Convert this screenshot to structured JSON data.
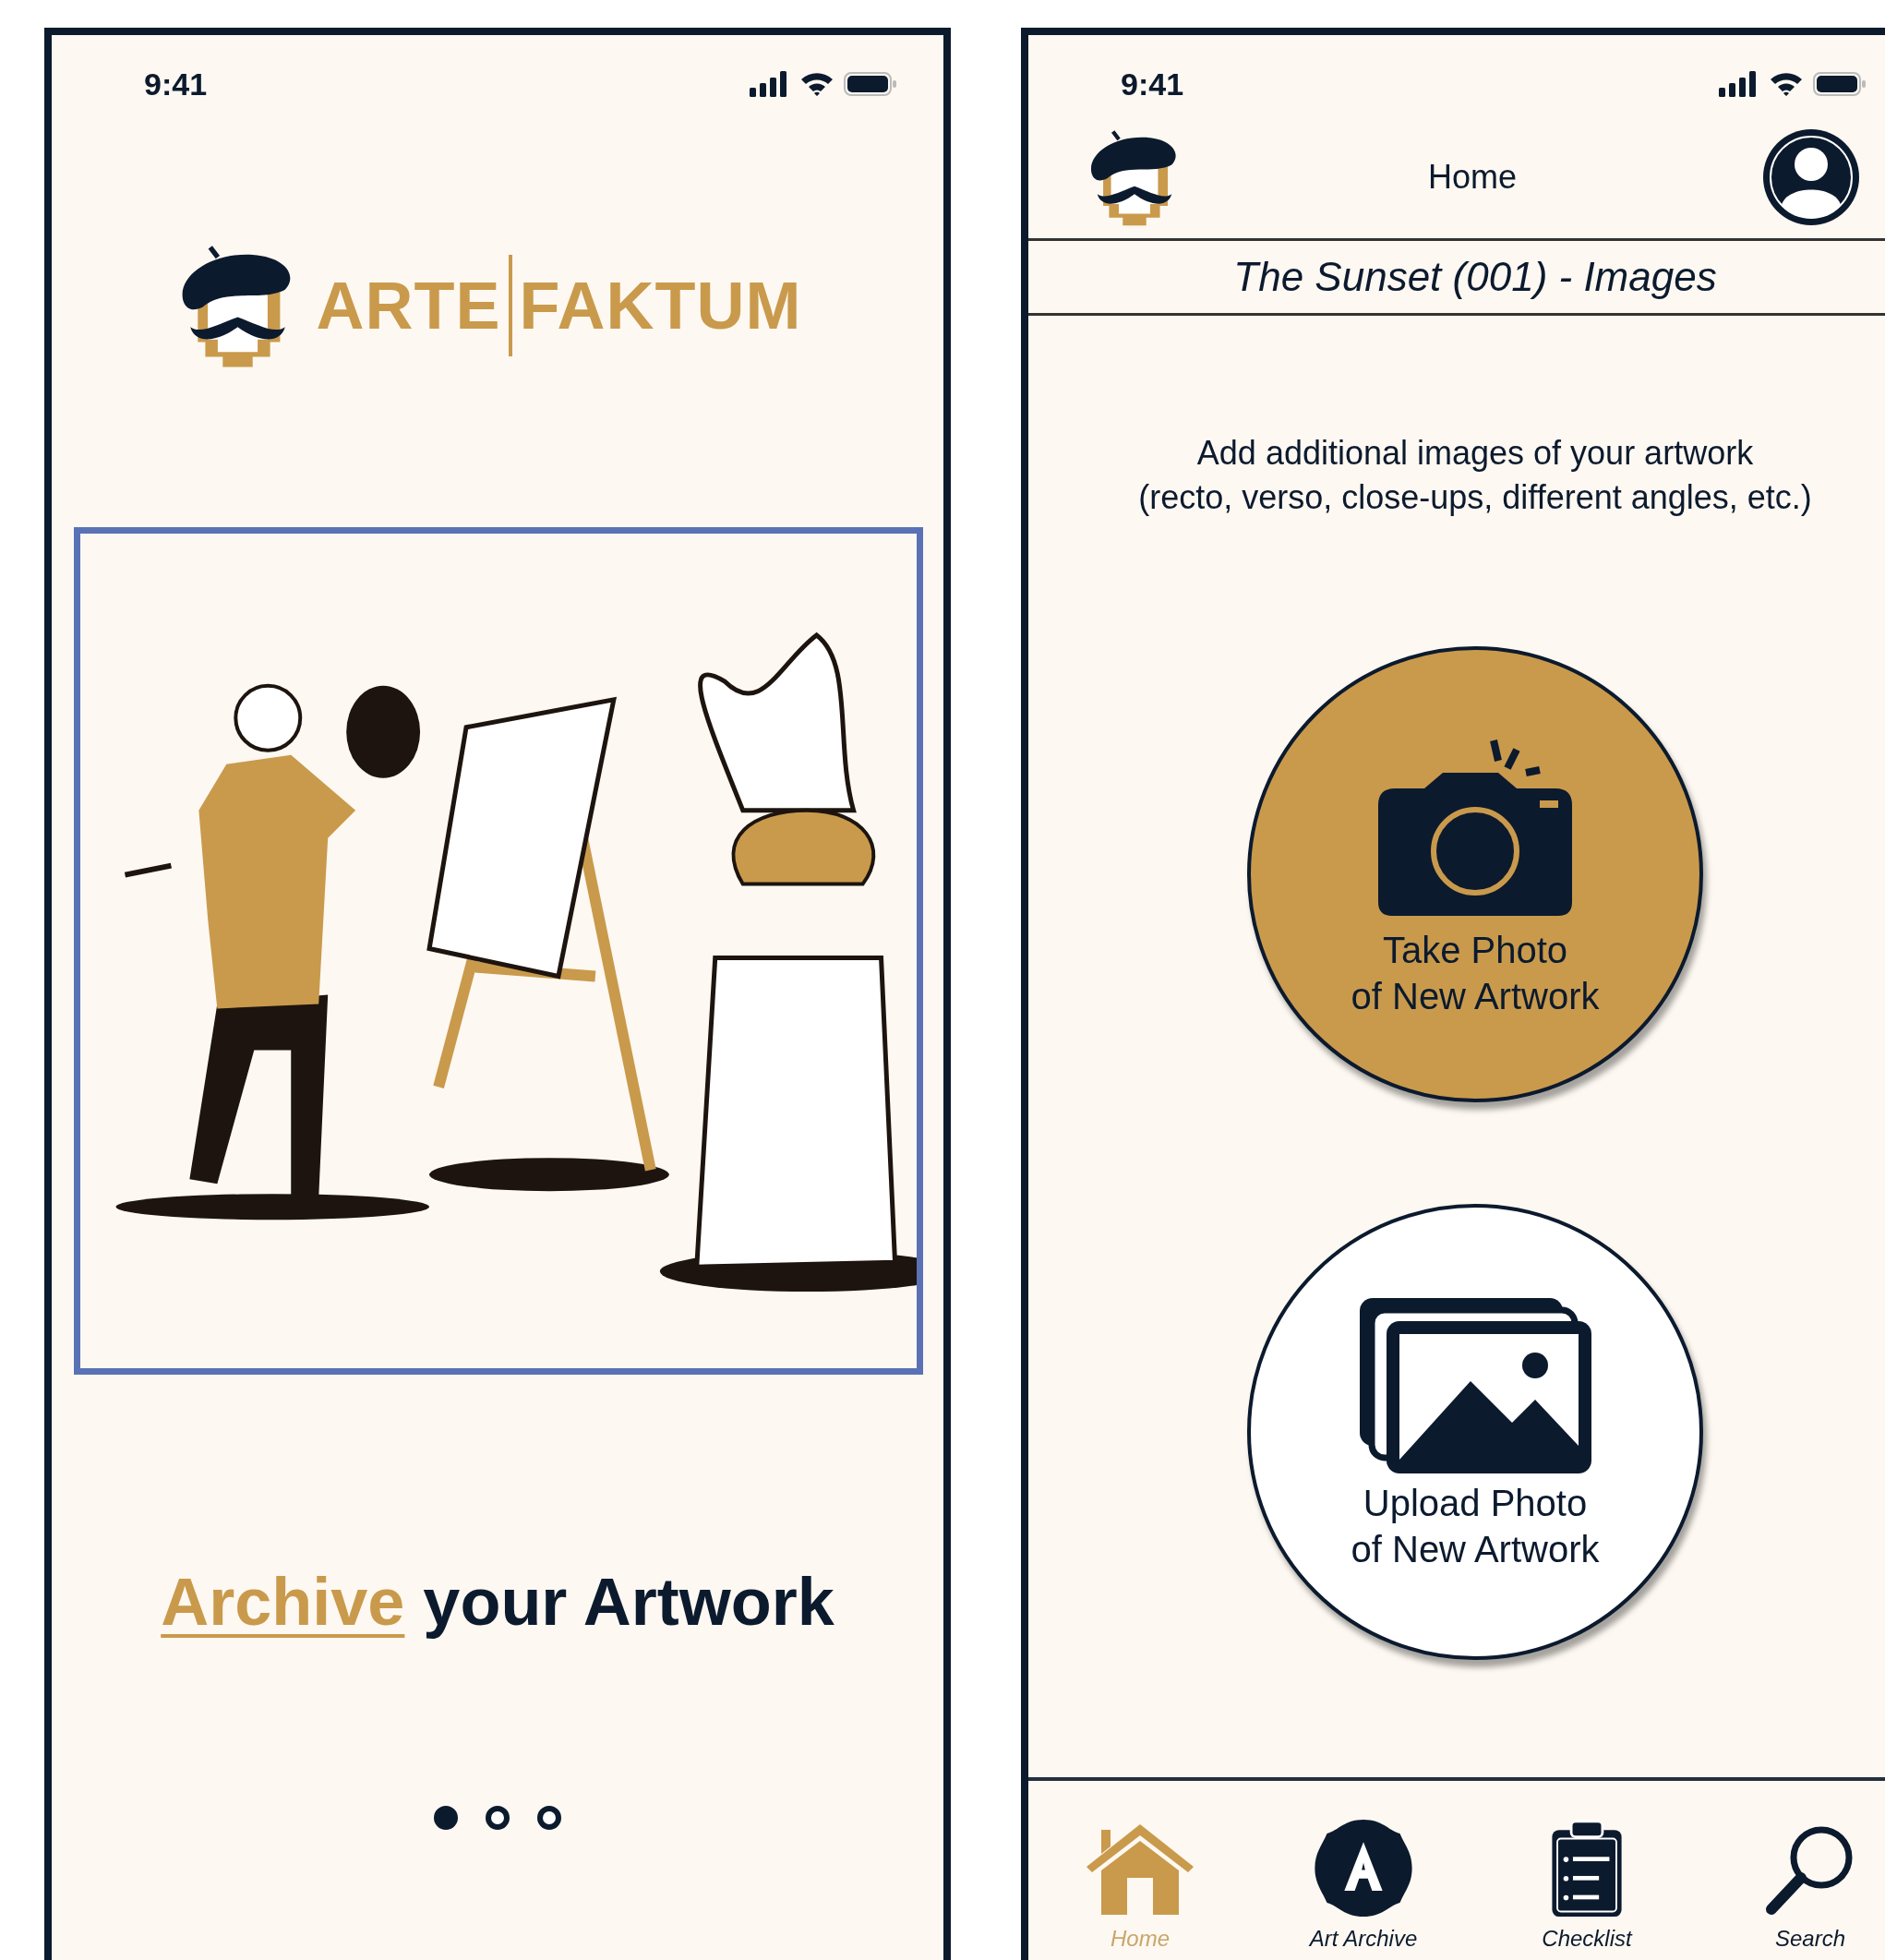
{
  "onboarding_screen": {
    "status_bar": {
      "time": "9:41"
    },
    "logo": {
      "word_1": "ARTE",
      "word_2": "FAKTUM"
    },
    "headline": {
      "highlight": "Archive",
      "rest": "your Artwork"
    },
    "pager": [
      {
        "selected": true
      },
      {
        "selected": false
      },
      {
        "selected": false
      }
    ]
  },
  "images_screen": {
    "status_bar": {
      "time": "9:41"
    },
    "header": {
      "title": "Home"
    },
    "subtitle": "The Sunset (001) - Images",
    "description": [
      "Add additional images of your artwork",
      "(recto, verso, close-ups, different angles, etc.)"
    ],
    "actions": [
      {
        "kind": "camera",
        "label": [
          "Take Photo",
          "of New Artwork"
        ]
      },
      {
        "kind": "upload",
        "label": [
          "Upload Photo",
          "of New Artwork"
        ]
      }
    ],
    "nav": [
      {
        "kind": "home",
        "label": "Home",
        "selected": true
      },
      {
        "kind": "archive",
        "label": "Art Archive",
        "selected": false
      },
      {
        "kind": "checklist",
        "label": "Checklist",
        "selected": false
      },
      {
        "kind": "search",
        "label": "Search",
        "selected": false
      }
    ]
  }
}
